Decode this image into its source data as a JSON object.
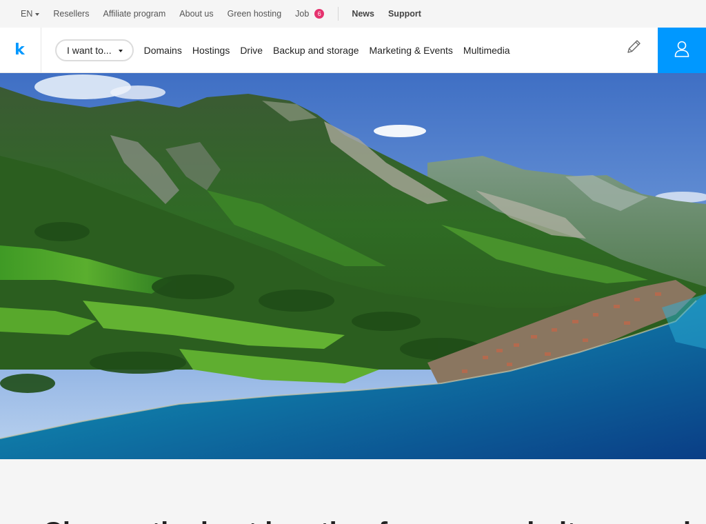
{
  "topbar": {
    "language": "EN",
    "links": [
      "Resellers",
      "Affiliate program",
      "About us",
      "Green hosting"
    ],
    "job_label": "Job",
    "job_count": "6",
    "news_label": "News",
    "support_label": "Support"
  },
  "header": {
    "logo_letter": "k",
    "iwant_label": "I want to...",
    "nav": [
      "Domains",
      "Hostings",
      "Drive",
      "Backup and storage",
      "Marketing & Events",
      "Multimedia"
    ]
  },
  "colors": {
    "accent": "#0098ff",
    "badge": "#e5326e"
  },
  "icons": {
    "edit": "pencil-icon",
    "account": "user-icon"
  },
  "hero": {
    "alt": "Aerial view of a green alpine valley with a lakeside village and turquoise lake"
  },
  "main": {
    "headline": "Choose the best location for your website, your domain or email"
  }
}
